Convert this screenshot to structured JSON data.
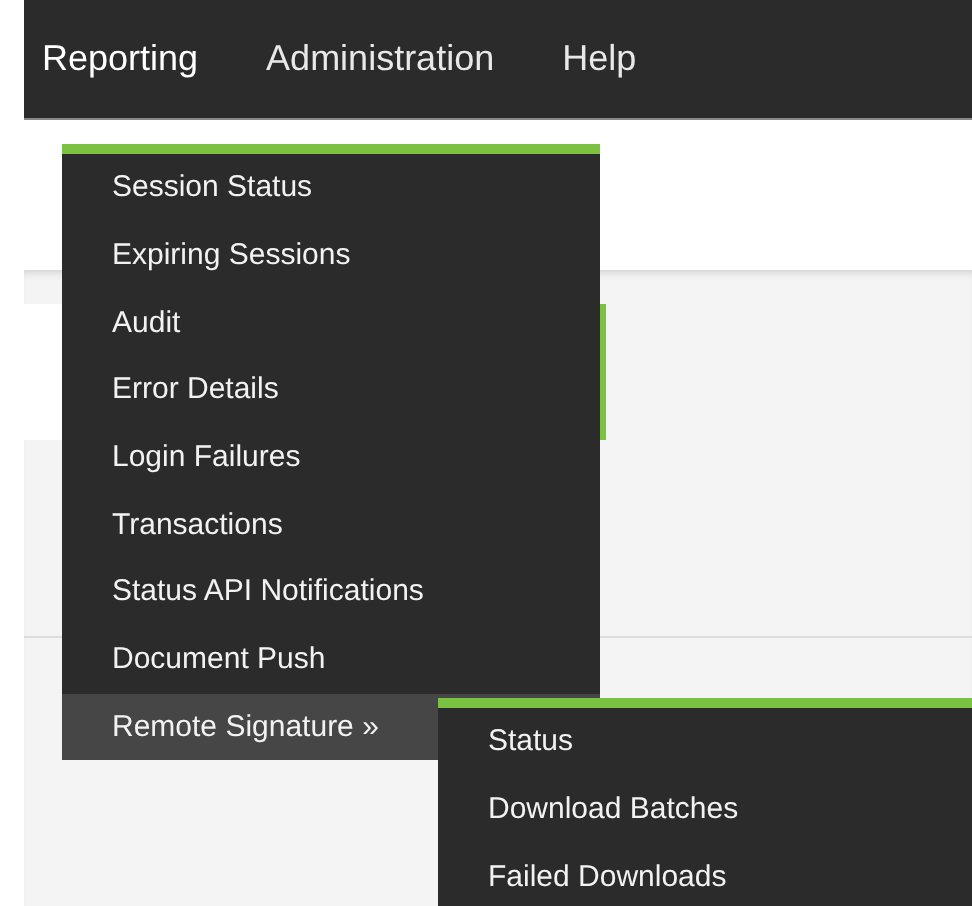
{
  "nav": {
    "items": [
      {
        "label": "Reporting",
        "selected": true
      },
      {
        "label": "Administration",
        "selected": false
      },
      {
        "label": "Help",
        "selected": false
      }
    ]
  },
  "menu": {
    "items": [
      {
        "label": "Session Status",
        "selected": false
      },
      {
        "label": "Expiring Sessions",
        "selected": false
      },
      {
        "label": "Audit",
        "selected": false
      },
      {
        "label": "Error Details",
        "selected": false
      },
      {
        "label": "Login Failures",
        "selected": false
      },
      {
        "label": "Transactions",
        "selected": false
      },
      {
        "label": "Status API Notifications",
        "selected": false
      },
      {
        "label": "Document Push",
        "selected": false
      },
      {
        "label": "Remote Signature »",
        "selected": true
      }
    ]
  },
  "submenu": {
    "items": [
      {
        "label": "Status",
        "selected": false
      },
      {
        "label": "Download Batches",
        "selected": false
      },
      {
        "label": "Failed Downloads",
        "selected": false
      }
    ]
  }
}
